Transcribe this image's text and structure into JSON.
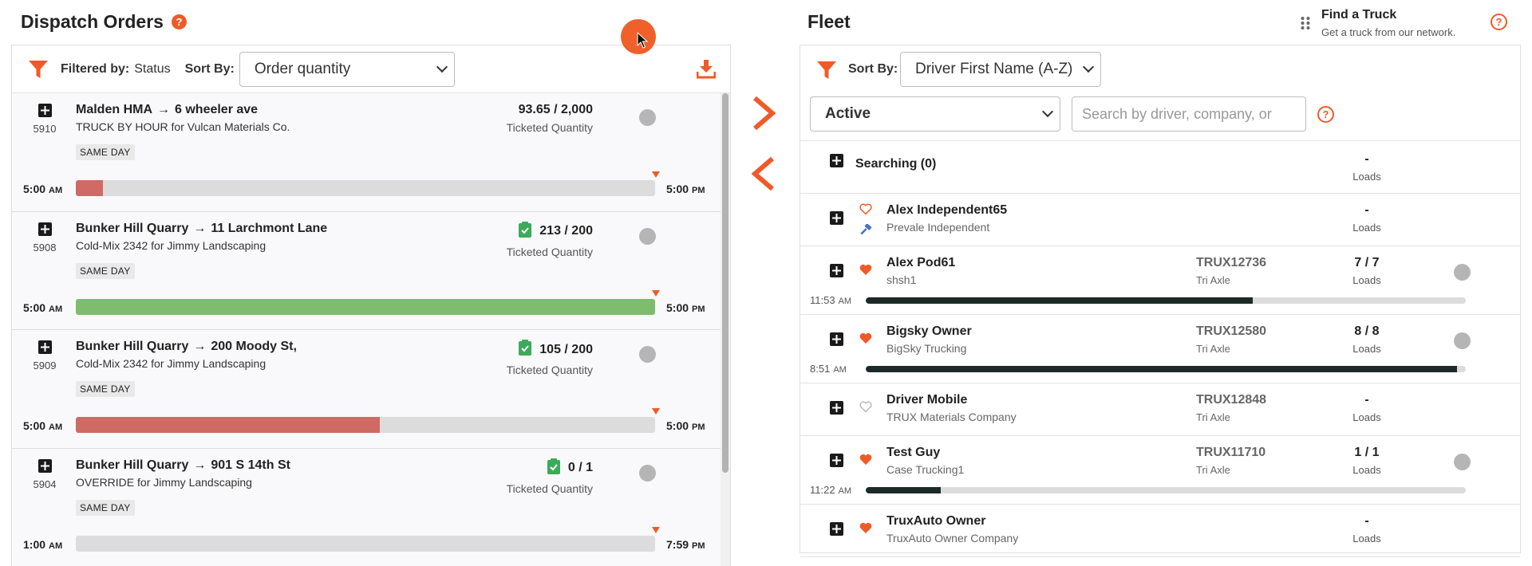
{
  "dispatch": {
    "title": "Dispatch Orders",
    "help_glyph": "?",
    "filtered_by_label": "Filtered by:",
    "filtered_by_value": "Status",
    "sort_by_label": "Sort By:",
    "sort_value": "Order quantity",
    "orders": [
      {
        "id": "5910",
        "origin": "Malden HMA",
        "arrow": "→",
        "destination": "6 wheeler ave",
        "subtitle": "TRUCK BY HOUR for Vulcan Materials Co.",
        "badge": "SAME DAY",
        "quantity": "93.65 / 2,000",
        "quantity_label": "Ticketed Quantity",
        "has_check": false,
        "start_time": "5:00",
        "start_ampm": "AM",
        "end_time": "5:00",
        "end_ampm": "PM",
        "progress": 0.047,
        "progress_color": "#d06a64"
      },
      {
        "id": "5908",
        "origin": "Bunker Hill Quarry",
        "arrow": "→",
        "destination": "11 Larchmont Lane",
        "subtitle": "Cold-Mix 2342 for Jimmy Landscaping",
        "badge": "SAME DAY",
        "quantity": "213 / 200",
        "quantity_label": "Ticketed Quantity",
        "has_check": true,
        "start_time": "5:00",
        "start_ampm": "AM",
        "end_time": "5:00",
        "end_ampm": "PM",
        "progress": 1.0,
        "progress_color": "#7dbd6b"
      },
      {
        "id": "5909",
        "origin": "Bunker Hill Quarry",
        "arrow": "→",
        "destination": "200 Moody St,",
        "subtitle": "Cold-Mix 2342 for Jimmy Landscaping",
        "badge": "SAME DAY",
        "quantity": "105 / 200",
        "quantity_label": "Ticketed Quantity",
        "has_check": true,
        "start_time": "5:00",
        "start_ampm": "AM",
        "end_time": "5:00",
        "end_ampm": "PM",
        "progress": 0.525,
        "progress_color": "#d06a64"
      },
      {
        "id": "5904",
        "origin": "Bunker Hill Quarry",
        "arrow": "→",
        "destination": "901 S 14th St",
        "subtitle": "OVERRIDE for Jimmy Landscaping",
        "badge": "SAME DAY",
        "quantity": "0 / 1",
        "quantity_label": "Ticketed Quantity",
        "has_check": true,
        "start_time": "1:00",
        "start_ampm": "AM",
        "end_time": "7:59",
        "end_ampm": "PM",
        "progress": 0.0,
        "progress_color": "#d06a64"
      }
    ]
  },
  "fleet": {
    "title": "Fleet",
    "find_truck_title": "Find a Truck",
    "find_truck_sub": "Get a truck from our network.",
    "help_glyph": "?",
    "sort_by_label": "Sort By:",
    "sort_value": "Driver First Name (A-Z)",
    "status_value": "Active",
    "search_placeholder": "Search by driver, company, or",
    "searching": {
      "label": "Searching (0)",
      "loads": "-",
      "loads_label": "Loads"
    },
    "drivers": [
      {
        "name": "Alex Independent65",
        "company": "Prevale Independent",
        "truck_id": "",
        "truck_type": "",
        "loads": "-",
        "loads_label": "Loads",
        "favorite": false,
        "has_wrench": true,
        "has_status": false,
        "has_progress": false
      },
      {
        "name": "Alex Pod61",
        "company": "shsh1",
        "truck_id": "TRUX12736",
        "truck_type": "Tri Axle",
        "loads": "7 / 7",
        "loads_label": "Loads",
        "favorite": true,
        "has_wrench": false,
        "has_status": true,
        "has_progress": true,
        "time": "11:53",
        "ampm": "AM",
        "progress": 0.645
      },
      {
        "name": "Bigsky Owner",
        "company": "BigSky Trucking",
        "truck_id": "TRUX12580",
        "truck_type": "Tri Axle",
        "loads": "8 / 8",
        "loads_label": "Loads",
        "favorite": true,
        "has_wrench": false,
        "has_status": true,
        "has_progress": true,
        "time": "8:51",
        "ampm": "AM",
        "progress": 0.985
      },
      {
        "name": "Driver Mobile",
        "company": "TRUX Materials Company",
        "truck_id": "TRUX12848",
        "truck_type": "Tri Axle",
        "loads": "-",
        "loads_label": "Loads",
        "favorite": false,
        "has_wrench": false,
        "has_status": false,
        "has_progress": false
      },
      {
        "name": "Test Guy",
        "company": "Case Trucking1",
        "truck_id": "TRUX11710",
        "truck_type": "Tri Axle",
        "loads": "1 / 1",
        "loads_label": "Loads",
        "favorite": true,
        "has_wrench": false,
        "has_status": true,
        "has_progress": true,
        "time": "11:22",
        "ampm": "AM",
        "progress": 0.125
      },
      {
        "name": "TruxAuto Owner",
        "company": "TruxAuto Owner Company",
        "truck_id": "",
        "truck_type": "",
        "loads": "-",
        "loads_label": "Loads",
        "favorite": true,
        "has_wrench": false,
        "has_status": false,
        "has_progress": false
      }
    ]
  },
  "colors": {
    "accent": "#f05a28",
    "status_dot": "#b5b5b5",
    "check_green": "#3bab5a",
    "progress_dark": "#1b2a26",
    "wrench_blue": "#4a72c4"
  },
  "icons": {
    "filter": "filter-icon",
    "download": "download-icon",
    "help": "help-icon",
    "add": "plus-square-icon",
    "favorite": "heart-icon",
    "transfer_right": "chevron-right-icon",
    "transfer_left": "chevron-left-icon",
    "drag": "drag-grip-icon",
    "cursor": "mouse-cursor-icon"
  }
}
